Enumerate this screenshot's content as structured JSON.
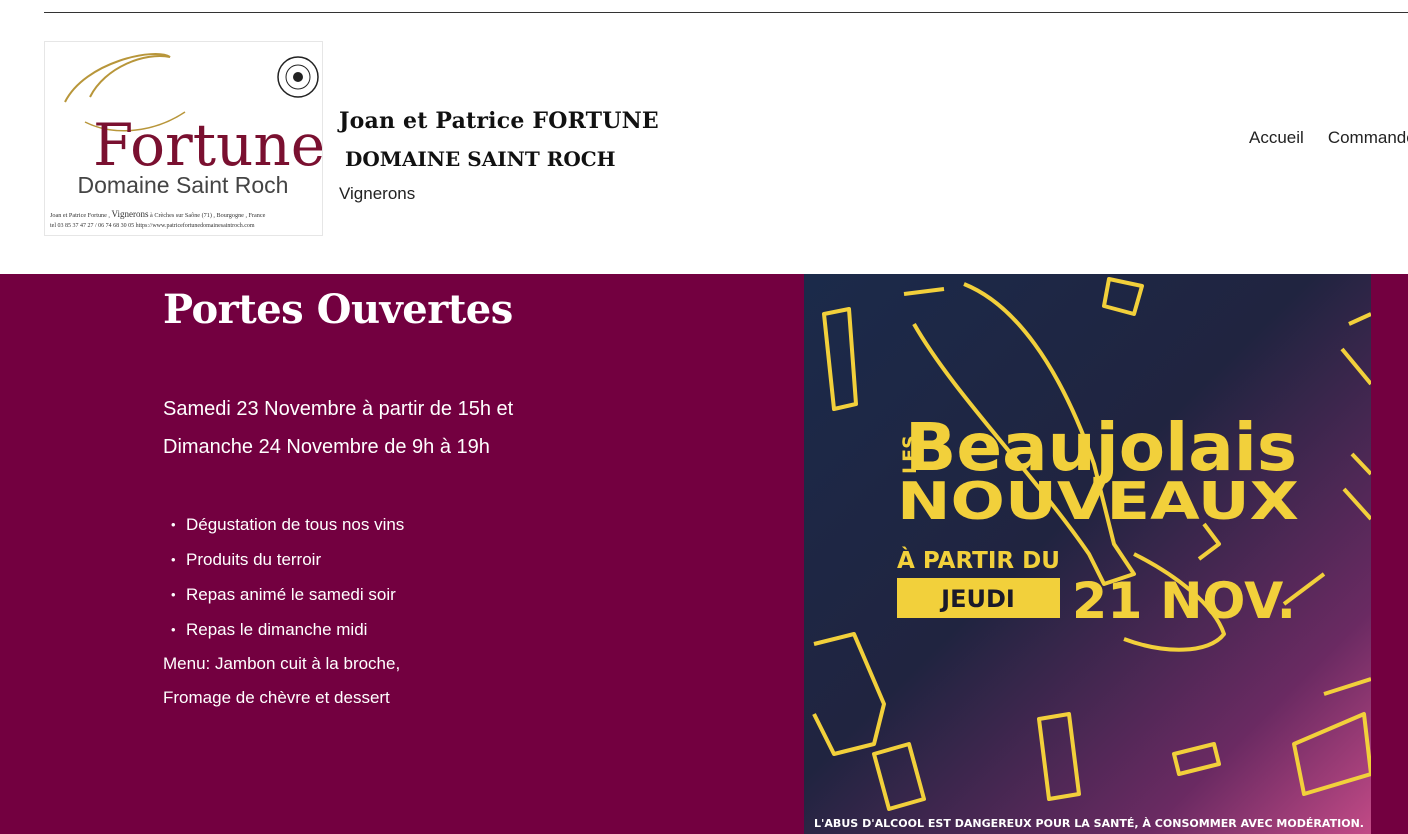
{
  "header": {
    "logo": {
      "wordmark": "Fortune",
      "subtitle": "Domaine Saint Roch",
      "contact_line1_a": "Joan et Patrice Fortune ,",
      "contact_line1_b": "Vignerons",
      "contact_line1_c": "à Crèches sur Saône (71) , Bourgogne , France",
      "contact_line2": "tel 03 85 37 47 27 / 06 74 68 30 05   https://www.patricefortunedomainesaintroch.com"
    },
    "title_line1": "Joan et Patrice FORTUNE",
    "title_line2": "DOMAINE SAINT ROCH",
    "tagline": "Vignerons",
    "nav": [
      "Accueil",
      "Commande"
    ]
  },
  "hero": {
    "title": "Portes Ouvertes",
    "dates": [
      "Samedi 23 Novembre à partir de 15h et",
      "Dimanche 24 Novembre de 9h à 19h"
    ],
    "bullets": [
      "Dégustation de tous nos vins",
      "Produits du terroir",
      "Repas animé le samedi soir",
      "Repas le dimanche midi"
    ],
    "menu": [
      "Menu: Jambon cuit à la broche,",
      "Fromage de chèvre et dessert"
    ]
  },
  "poster": {
    "les": "LES",
    "beaujolais": "Beaujolais",
    "nouveaux": "NOUVEAUX",
    "a_partir_du": "À PARTIR DU",
    "jeudi": "JEUDI",
    "date": "21 NOV.",
    "disclaimer": "L'ABUS D'ALCOOL EST DANGEREUX POUR LA SANTÉ, À CONSOMMER AVEC MODÉRATION."
  },
  "colors": {
    "hero_bg": "#730040",
    "poster_accent": "#f2d03b",
    "logo_red": "#7a1030",
    "logo_gold": "#b8963a"
  }
}
